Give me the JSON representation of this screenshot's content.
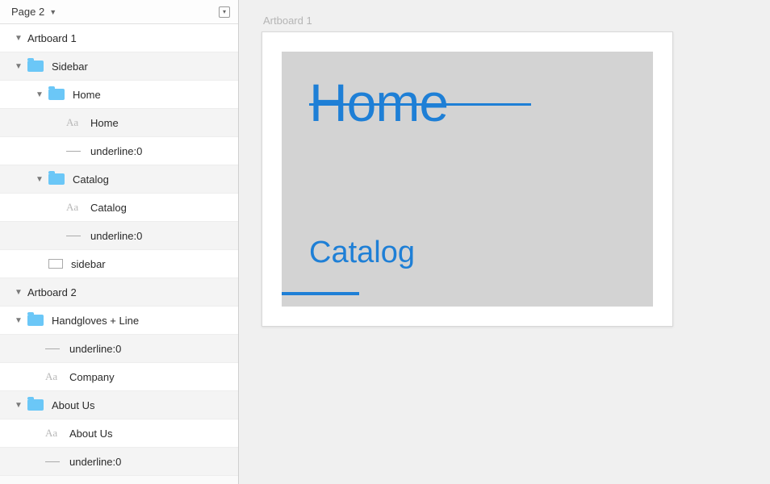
{
  "header": {
    "page_label": "Page 2"
  },
  "layers": {
    "artboard1": "Artboard 1",
    "sidebar": "Sidebar",
    "home_folder": "Home",
    "home_text": "Home",
    "home_underline": "underline:0",
    "catalog_folder": "Catalog",
    "catalog_text": "Catalog",
    "catalog_underline": "underline:0",
    "sidebar_rect": "sidebar",
    "artboard2": "Artboard 2",
    "handgloves": "Handgloves + Line",
    "hg_underline": "underline:0",
    "company_text": "Company",
    "aboutus_folder": "About Us",
    "aboutus_text": "About Us",
    "aboutus_underline": "underline:0"
  },
  "canvas": {
    "artboard_label": "Artboard 1",
    "home": "Home",
    "catalog": "Catalog"
  }
}
